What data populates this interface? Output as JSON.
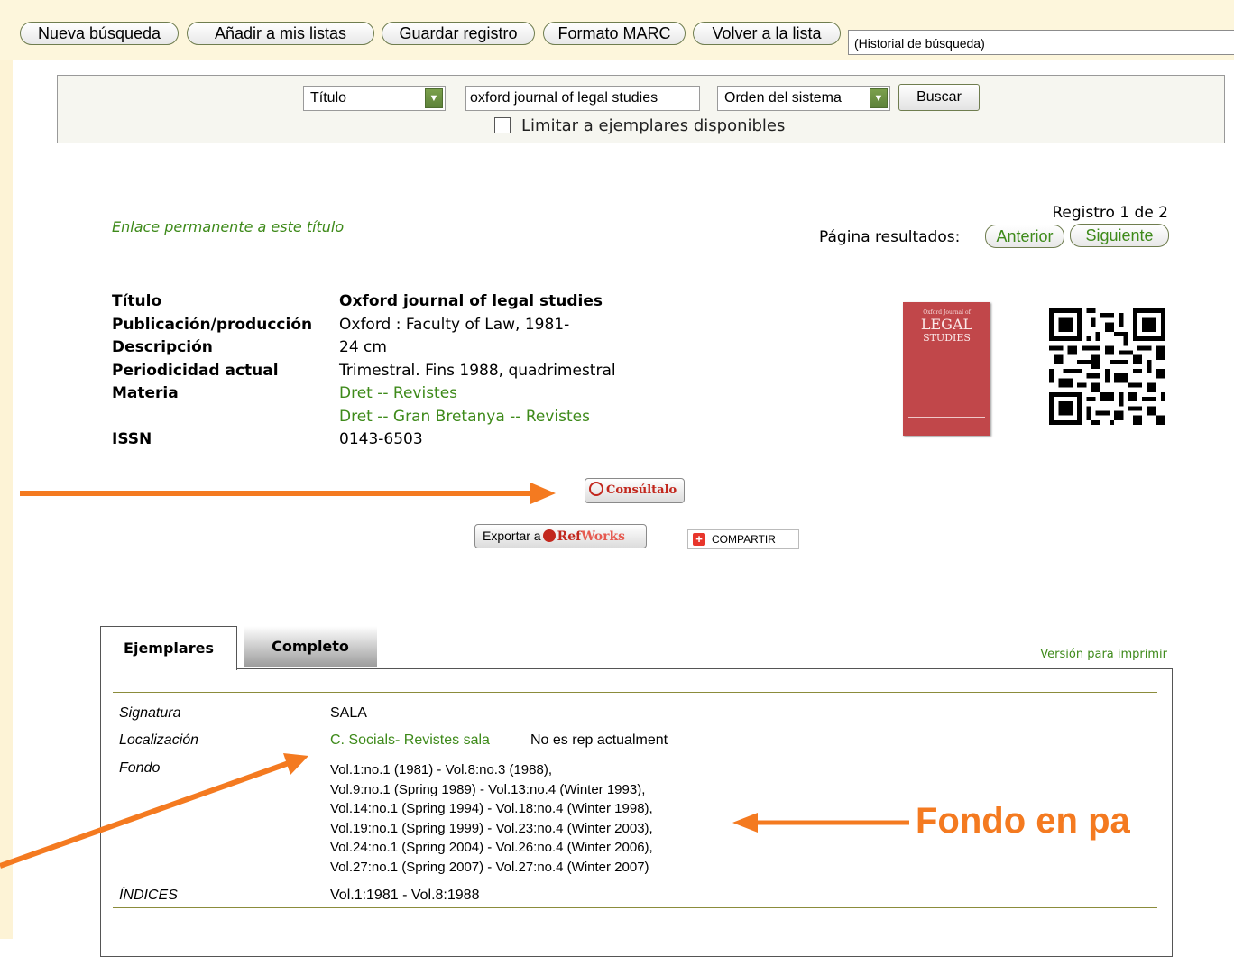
{
  "toolbar": {
    "buttons": [
      "Nueva búsqueda",
      "Añadir a mis listas",
      "Guardar registro",
      "Formato MARC",
      "Volver a la lista"
    ],
    "history": "(Historial de búsqueda)"
  },
  "search": {
    "field": "Título",
    "query": "oxford journal of legal studies",
    "sort": "Orden del sistema",
    "submit": "Buscar",
    "limit_label": "Limitar a ejemplares disponibles"
  },
  "record_nav": {
    "permalink": "Enlace permanente a este título",
    "counter": "Registro 1 de 2",
    "results_label": "Página resultados:",
    "prev": "Anterior",
    "next": "Siguiente"
  },
  "record": {
    "rows": [
      {
        "label": "Título",
        "value": "Oxford journal of legal studies"
      },
      {
        "label": "Publicación/producción",
        "value": "Oxford : Faculty of Law, 1981-"
      },
      {
        "label": "Descripción",
        "value": "24 cm"
      },
      {
        "label": "Periodicidad actual",
        "value": "Trimestral. Fins 1988, quadrimestral"
      },
      {
        "label": "Materia",
        "value": "Dret -- Revistes"
      },
      {
        "label": "",
        "value": "Dret -- Gran Bretanya -- Revistes"
      },
      {
        "label": "ISSN",
        "value": "0143-6503"
      }
    ]
  },
  "cover": {
    "small": "Oxford Journal of",
    "big": "LEGAL",
    "sub": "STUDIES"
  },
  "actions": {
    "consultalo": "Consúltalo",
    "export_prefix": "Exportar a",
    "export_brand_a": "Ref",
    "export_brand_b": "Works",
    "share": "COMPARTIR"
  },
  "tabs": {
    "items": [
      "Ejemplares",
      "Completo"
    ],
    "print": "Versión para imprimir"
  },
  "holdings": {
    "signatura_label": "Signatura",
    "signatura": "SALA",
    "localizacion_label": "Localización",
    "localizacion_link": "C. Socials- Revistes sala",
    "localizacion_status": "No es rep actualment",
    "fondo_label": "Fondo",
    "fondo": [
      "Vol.1:no.1 (1981) - Vol.8:no.3 (1988),",
      "Vol.9:no.1 (Spring 1989) - Vol.13:no.4 (Winter 1993),",
      "Vol.14:no.1 (Spring 1994) - Vol.18:no.4 (Winter 1998),",
      "Vol.19:no.1 (Spring 1999) - Vol.23:no.4 (Winter 2003),",
      "Vol.24:no.1 (Spring 2004) - Vol.26:no.4 (Winter 2006),",
      "Vol.27:no.1 (Spring 2007) - Vol.27:no.4 (Winter 2007)"
    ],
    "indices_label": "ÍNDICES",
    "indices": "Vol.1:1981 - Vol.8:1988"
  },
  "annotation": "Fondo en pa",
  "colors": {
    "accent_green": "#3e8a1a",
    "arrow_orange": "#f47a20",
    "rule_olive": "#8b8c3b"
  }
}
